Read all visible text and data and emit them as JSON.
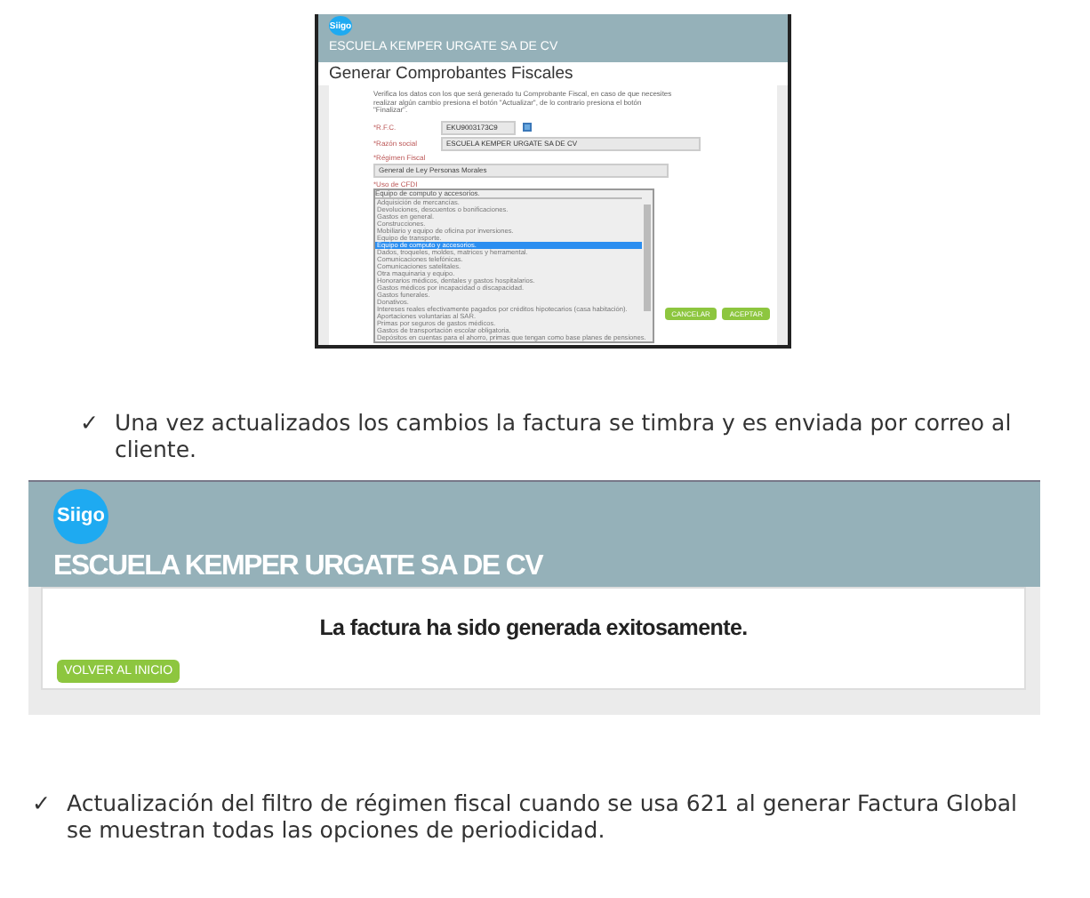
{
  "screenshot_form": {
    "logo": "Siigo",
    "company": "ESCUELA KEMPER URGATE SA DE CV",
    "title": "Generar Comprobantes Fiscales",
    "instructions": "Verifica los datos con los que será generado tu Comprobante Fiscal, en caso de que necesites realizar algún cambio presiona el botón \"Actualizar\", de lo contrario presiona el botón \"Finalizar\".",
    "fields": [
      {
        "label": "*R.F.C.",
        "value": "EKU9003173C9",
        "kind": "short"
      },
      {
        "label": "*Razón social",
        "value": "ESCUELA KEMPER URGATE SA DE CV",
        "kind": "wide"
      },
      {
        "label": "*Régimen Fiscal",
        "value": "General de Ley Personas Morales",
        "kind": "select"
      }
    ],
    "cfdi": {
      "label": "*Uso de CFDI",
      "value": "Equipo de computo y accesorios.",
      "options": [
        {
          "text": "Adquisición de mercancías.",
          "selected": false
        },
        {
          "text": "Devoluciones, descuentos o bonificaciones.",
          "selected": false
        },
        {
          "text": "Gastos en general.",
          "selected": false
        },
        {
          "text": "Construcciones.",
          "selected": false
        },
        {
          "text": "Mobiliario y equipo de oficina por inversiones.",
          "selected": false
        },
        {
          "text": "Equipo de transporte.",
          "selected": false
        },
        {
          "text": "Equipo de computo y accesorios.",
          "selected": true
        },
        {
          "text": "Dados, troqueles, moldes, matrices y herramental.",
          "selected": false
        },
        {
          "text": "Comunicaciones telefónicas.",
          "selected": false
        },
        {
          "text": "Comunicaciones satelitales.",
          "selected": false
        },
        {
          "text": "Otra maquinaria y equipo.",
          "selected": false
        },
        {
          "text": "Honorarios médicos, dentales y gastos hospitalarios.",
          "selected": false
        },
        {
          "text": "Gastos médicos por incapacidad o discapacidad.",
          "selected": false
        },
        {
          "text": "Gastos funerales.",
          "selected": false
        },
        {
          "text": "Donativos.",
          "selected": false
        },
        {
          "text": "Intereses reales efectivamente pagados por créditos hipotecarios (casa habitación).",
          "selected": false
        },
        {
          "text": "Aportaciones voluntarias al SAR.",
          "selected": false
        },
        {
          "text": "Primas por seguros de gastos médicos.",
          "selected": false
        },
        {
          "text": "Gastos de transportación escolar obligatoria.",
          "selected": false
        },
        {
          "text": "Depósitos en cuentas para el ahorro, primas que tengan como base planes de pensiones.",
          "selected": false
        }
      ]
    },
    "buttons": [
      "CANCELAR",
      "ACEPTAR"
    ]
  },
  "bullet_1": {
    "mark": "✓",
    "text": "Una vez actualizados los cambios la factura se timbra y es enviada por correo al cliente."
  },
  "screenshot_success": {
    "logo": "Siigo",
    "company": "ESCUELA KEMPER URGATE SA DE CV",
    "message": "La factura ha sido generada exitosamente.",
    "button": "VOLVER AL INICIO"
  },
  "bullet_2": {
    "mark": "✓",
    "text": "Actualización del filtro de régimen fiscal cuando se usa 621 al generar Factura Global se muestran todas las opciones de periodicidad."
  }
}
